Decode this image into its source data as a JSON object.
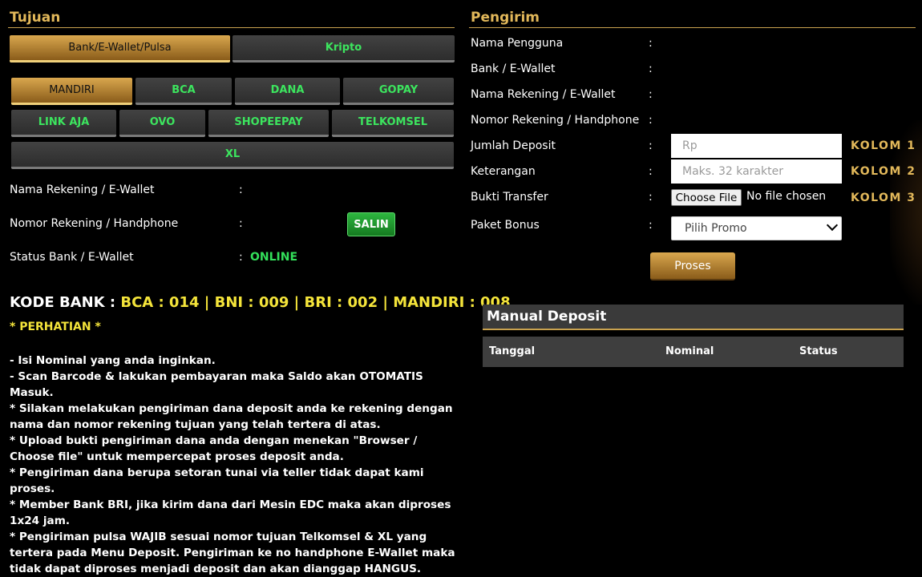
{
  "tujuan": {
    "title": "Tujuan",
    "tabs": [
      {
        "label": "Bank/E-Wallet/Pulsa",
        "active": true
      },
      {
        "label": "Kripto",
        "active": false
      }
    ],
    "banks": [
      "MANDIRI",
      "BCA",
      "DANA",
      "GOPAY",
      "LINK AJA",
      "OVO",
      "SHOPEEPAY",
      "TELKOMSEL",
      "XL"
    ],
    "selected_bank": "MANDIRI",
    "info_rows": {
      "nama_rekening": {
        "label": "Nama Rekening / E-Wallet",
        "colon": ":"
      },
      "nomor_rekening": {
        "label": "Nomor Rekening / Handphone",
        "colon": ":",
        "copy_button": "SALIN"
      },
      "status_bank": {
        "label": "Status Bank / E-Wallet",
        "colon": ":",
        "value": "ONLINE"
      }
    },
    "kode_bank": {
      "prefix": "KODE BANK : ",
      "codes": "BCA : 014 | BNI : 009 | BRI : 002 | MANDIRI : 008"
    },
    "perhatian": "* PERHATIAN *",
    "notes": [
      "- Isi Nominal yang anda inginkan.",
      "- Scan Barcode & lakukan pembayaran maka Saldo akan OTOMATIS Masuk.",
      "* Silakan melakukan pengiriman dana deposit anda ke rekening dengan nama dan nomor rekening tujuan yang telah tertera di atas.",
      "* Upload bukti pengiriman dana anda dengan menekan \"Browser / Choose file\" untuk mempercepat proses deposit anda.",
      "* Pengiriman dana berupa setoran tunai via teller tidak dapat kami proses.",
      "* Member Bank BRI, jika kirim dana dari Mesin EDC maka akan diproses 1x24 jam.",
      "* Pengiriman pulsa WAJIB sesuai nomor tujuan Telkomsel & XL yang tertera pada Menu Deposit. Pengiriman ke no handphone E-Wallet maka tidak dapat diproses menjadi deposit dan akan dianggap HANGUS."
    ]
  },
  "pengirim": {
    "title": "Pengirim",
    "rows": {
      "nama_pengguna": {
        "label": "Nama Pengguna",
        "colon": ":"
      },
      "bank_ewallet": {
        "label": "Bank / E-Wallet",
        "colon": ":"
      },
      "nama_rekening": {
        "label": "Nama Rekening / E-Wallet",
        "colon": ":"
      },
      "nomor_rekening": {
        "label": "Nomor Rekening / Handphone",
        "colon": ":"
      },
      "jumlah_deposit": {
        "label": "Jumlah Deposit",
        "colon": ":",
        "placeholder": "Rp",
        "kolom": "KOLOM 1"
      },
      "keterangan": {
        "label": "Keterangan",
        "colon": ":",
        "placeholder": "Maks. 32 karakter",
        "kolom": "KOLOM 2"
      },
      "bukti_transfer": {
        "label": "Bukti Transfer",
        "colon": ":",
        "choose_file": "Choose File",
        "no_file": "No file chosen",
        "kolom": "KOLOM 3"
      },
      "paket_bonus": {
        "label": "Paket Bonus",
        "colon": ":",
        "selected": "Pilih Promo"
      }
    },
    "submit_label": "Proses"
  },
  "manual_deposit": {
    "title": "Manual Deposit",
    "columns": [
      "Tanggal",
      "Nominal",
      "Status"
    ]
  },
  "colors": {
    "gold": "#e2b85a",
    "green": "#3ce55e",
    "yellow": "#f4e43a",
    "background": "#000000"
  }
}
